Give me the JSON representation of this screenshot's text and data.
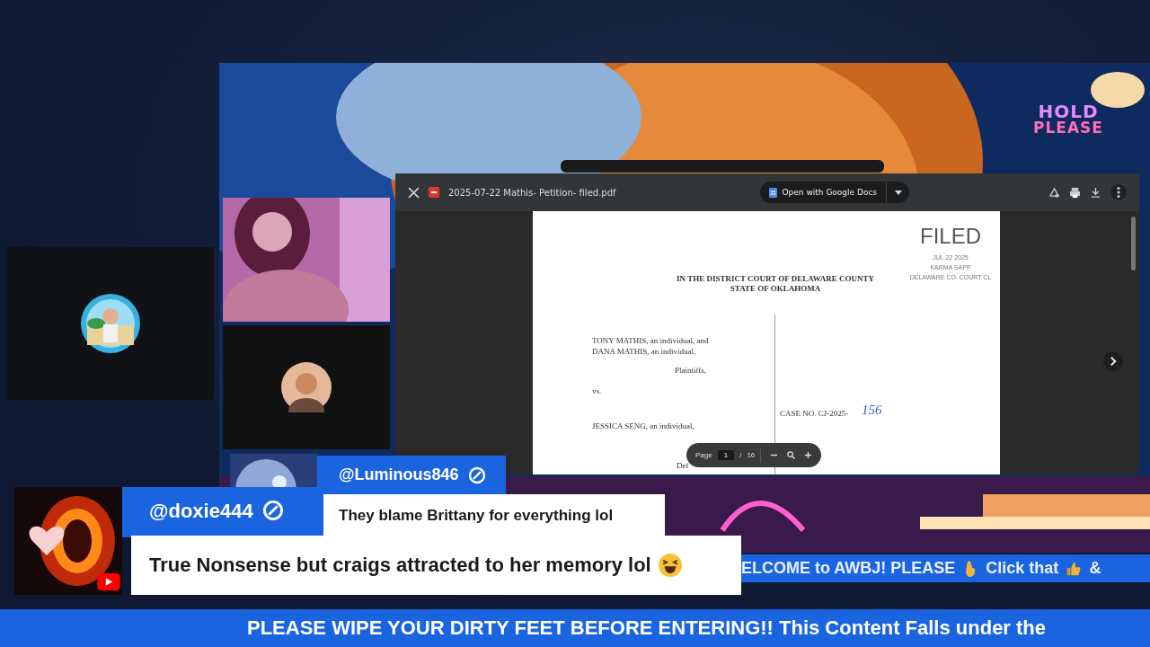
{
  "stream_overlay": {
    "hold_lines": [
      "HOLD",
      "PLEASE"
    ]
  },
  "pdf_viewer": {
    "file_name": "2025-07-22 Mathis- Petition- filed.pdf",
    "open_button": "Open with Google Docs",
    "document": {
      "stamp": [
        "FILED",
        "JUL 22 2025",
        "KARMA SAPP",
        "DELAWARE CO. COURT CL"
      ],
      "heading": [
        "IN THE DISTRICT COURT OF DELAWARE COUNTY",
        "STATE OF OKLAHOMA"
      ],
      "plaintiffs": [
        "TONY MATHIS, an individual, and",
        "DANA MATHIS, an individual,"
      ],
      "plaintiffs_label": "Plaintiffs,",
      "versus": "vs.",
      "defendant": "JESSICA SENG, an individual,",
      "defendant_label": "Def",
      "case_no": "CASE NO. CJ-2025-",
      "case_number_handwritten": "156"
    },
    "page_toolbar": {
      "label": "Page",
      "page": "1",
      "separator": "/",
      "total": "16"
    }
  },
  "chat": [
    {
      "user": "@Luminous846",
      "text": "They blame Brittany for everything lol",
      "laughing_emoji": false
    },
    {
      "user": "@doxie444",
      "text": "True Nonsense but craigs attracted to her memory lol",
      "laughing_emoji": true
    }
  ],
  "ticker": [
    {
      "kind": "text",
      "text": "ELCOME to AWBJ! PLEASE"
    },
    {
      "kind": "hand"
    },
    {
      "kind": "text",
      "text": "Click that"
    },
    {
      "kind": "thumb"
    },
    {
      "kind": "text",
      "text": "&"
    }
  ],
  "banner": "PLEASE WIPE YOUR DIRTY FEET BEFORE ENTERING!! This Content Falls under the"
}
